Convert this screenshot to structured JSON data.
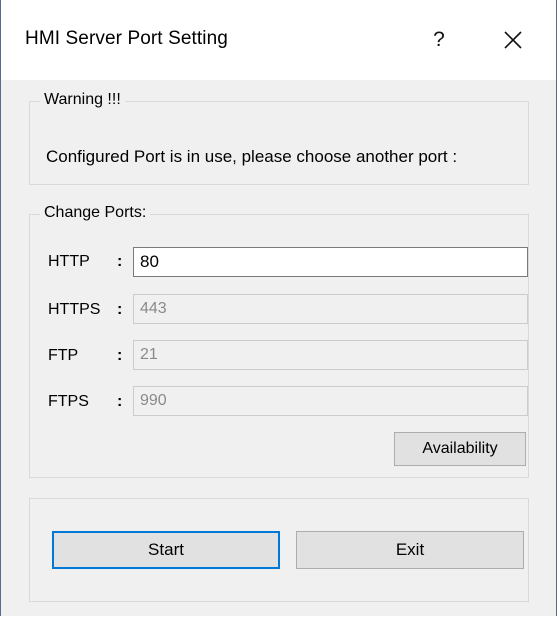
{
  "window": {
    "title": "HMI Server Port Setting",
    "help_label": "?",
    "close_icon": "close-icon"
  },
  "warning": {
    "group_label": "Warning !!!",
    "message": "Configured Port is in use, please choose another port :"
  },
  "ports": {
    "group_label": "Change Ports:",
    "items": [
      {
        "label": "HTTP",
        "colon": ":",
        "value": "80",
        "enabled": true
      },
      {
        "label": "HTTPS",
        "colon": ":",
        "value": "443",
        "enabled": false
      },
      {
        "label": "FTP",
        "colon": ":",
        "value": "21",
        "enabled": false
      },
      {
        "label": "FTPS",
        "colon": ":",
        "value": "990",
        "enabled": false
      }
    ],
    "availability_label": "Availability"
  },
  "actions": {
    "start_label": "Start",
    "exit_label": "Exit"
  },
  "colors": {
    "window_background": "#f0f0f0",
    "titlebar_background": "#ffffff",
    "default_button_border": "#0078d7",
    "disabled_text": "#8a8a8a"
  }
}
